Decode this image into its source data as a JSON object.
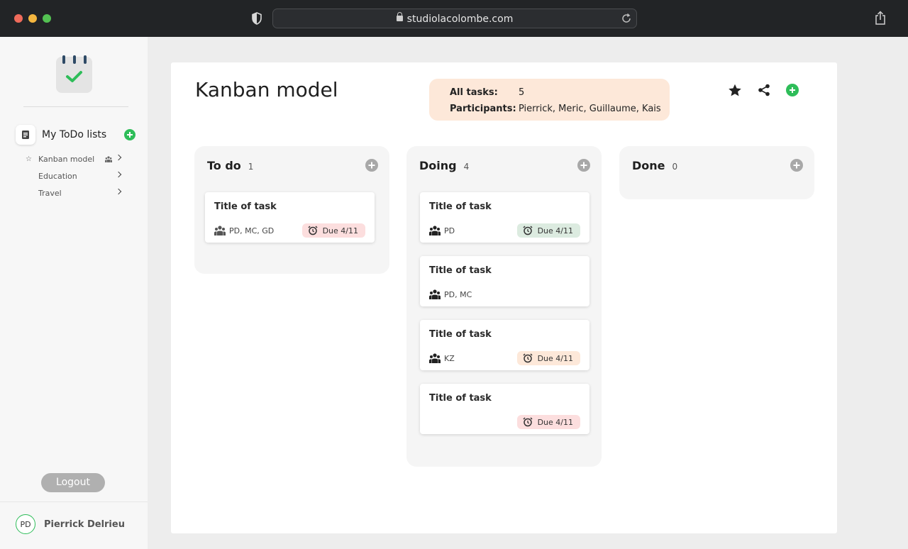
{
  "browser": {
    "url": "studiolacolombe.com"
  },
  "sidebar": {
    "list_title": "My ToDo lists",
    "items": [
      {
        "label": "Kanban model",
        "starred": true,
        "shared": true
      },
      {
        "label": "Education",
        "starred": false,
        "shared": false
      },
      {
        "label": "Travel",
        "starred": false,
        "shared": false
      }
    ],
    "logout_label": "Logout",
    "user": {
      "initials": "PD",
      "name": "Pierrick Delrieu"
    }
  },
  "board": {
    "title": "Kanban model",
    "info": {
      "all_tasks_label": "All tasks:",
      "all_tasks_value": "5",
      "participants_label": "Participants:",
      "participants_value": "Pierrick, Meric, Guillaume, Kais"
    }
  },
  "columns": [
    {
      "name": "To do",
      "count": "1",
      "cards": [
        {
          "title": "Title of task",
          "people": "PD, MC, GD",
          "due": "Due 4/11",
          "due_color": "#fcdede"
        }
      ]
    },
    {
      "name": "Doing",
      "count": "4",
      "cards": [
        {
          "title": "Title of task",
          "people": "PD",
          "due": "Due 4/11",
          "due_color": "#dcebe0"
        },
        {
          "title": "Title of task",
          "people": "PD, MC",
          "due": null
        },
        {
          "title": "Title of task",
          "people": "KZ",
          "due": "Due 4/11",
          "due_color": "#fde8d9"
        },
        {
          "title": "Title of task",
          "people": "",
          "due": "Due 4/11",
          "due_color": "#fcdede"
        }
      ]
    },
    {
      "name": "Done",
      "count": "0",
      "cards": []
    }
  ],
  "colors": {
    "accent_green": "#2ebd59",
    "info_bg": "#fde8d9"
  },
  "icons": [
    "shield-icon",
    "lock-icon",
    "reload-icon",
    "share-icon",
    "calendar-check-icon",
    "document-icon",
    "add-icon",
    "star-icon",
    "people-icon",
    "chevron-right-icon",
    "alarm-clock-icon"
  ]
}
